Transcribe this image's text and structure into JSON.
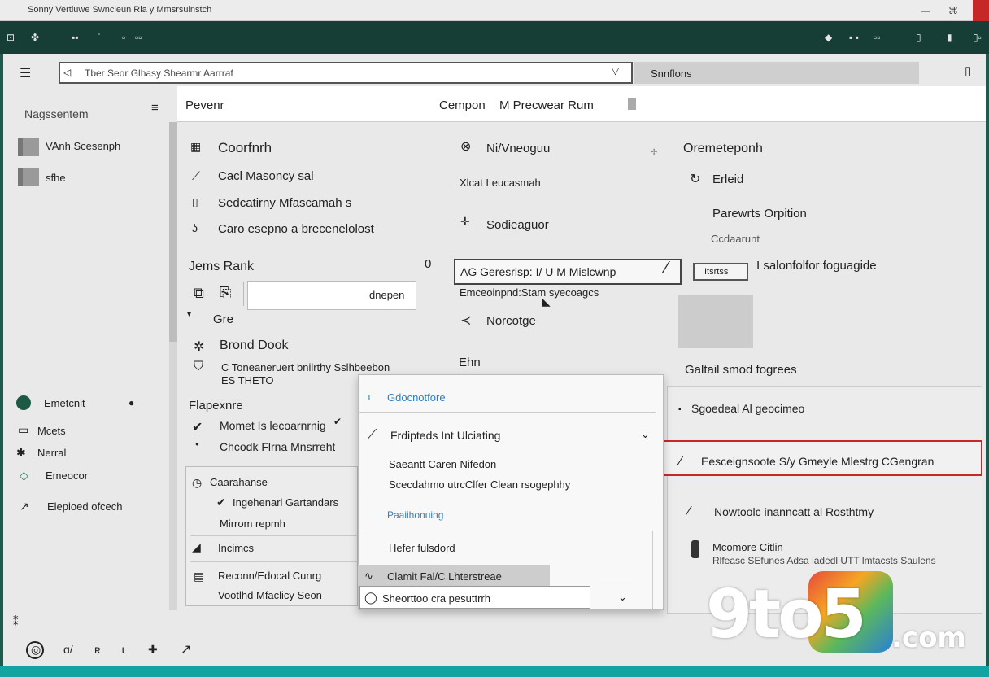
{
  "window": {
    "title": "Sonny Vertiuwe Swncleun Ria y Mmsrsulnstch"
  },
  "topbar": {
    "left_icons": [
      "⊡",
      "✤",
      "▪▪",
      "ˈ",
      "▫",
      "▫▫"
    ],
    "right_icons": [
      "◆",
      "▪ ▪",
      "▫▫",
      "▯",
      "▮",
      "▯▫"
    ]
  },
  "header": {
    "address_text": "Tber Seor Glhasy Shearmr Aarrraf",
    "search_label": "Snnflons"
  },
  "sidebar": {
    "title": "Nagssentem",
    "items": [
      {
        "label": "VAnh Scesenph"
      },
      {
        "label": "sfhe"
      }
    ],
    "lower_items": [
      {
        "icon": "●",
        "label": "Emetcnit"
      },
      {
        "icon": "▭",
        "label": "Mcets"
      },
      {
        "icon": "✱",
        "label": "Nerral"
      },
      {
        "icon": "◇",
        "label": "Emeocor"
      },
      {
        "icon": "↗",
        "label": "Elepioed ofcech"
      }
    ]
  },
  "tabbar": {
    "left_label": "Pevenr",
    "center_label": "Cempon",
    "center_label2": "M Precwear Rum"
  },
  "main": {
    "col1": {
      "heading": "Coorfnrh",
      "items": [
        "Cacl Masoncy sal",
        "Sedcatirny Mfascamah s",
        "Caro esepno a brecenelolost"
      ],
      "section": "Jems Rank",
      "input_value": "dnepen",
      "zero": "0",
      "sub": "Gre",
      "brand_heading": "Brond Dook",
      "brand_line1": "C Toneaneruert bnilrthy Sslhbeebon",
      "brand_line2": "ES THETO",
      "group_heading": "Flapexnre",
      "group_items": [
        "Momet Is lecoarnrnig",
        "Chcodk Flrna Mnsrreht"
      ],
      "list_heading": "Caarahanse",
      "list_items": [
        "Ingehenarl Gartandars",
        "Mirrom repmh",
        "Incimcs",
        "Reconn/Edocal Cunrg",
        "Vootlhd Mfaclicy Seon"
      ]
    },
    "col2": {
      "rows": [
        "Ni/Vneoguu",
        "Xlcat Leucasmah",
        "Sodieaguor"
      ],
      "combo_value": "AG Geresrisp: I/ U M Mislcwnp",
      "combo_sub": "Emceoinpnd:Stam syecoagcs",
      "row_after": "Norcotge",
      "label_eh": "Ehn"
    },
    "col3": {
      "heading": "Oremeteponh",
      "bullet": "Erleid",
      "sub_heading": "Parewrts Orpition",
      "caption": "Ccdaarunt",
      "mini_btn": "Itsrtss",
      "right_text": "I salonfolfor foguagide",
      "section": "Galtail smod fogrees"
    }
  },
  "dropdown": {
    "header": "Gdocnotfore",
    "item1": "Frdipteds Int Ulciating",
    "item2": "Saeantt Caren Nifedon",
    "item3": "Scecdahmo utrcClfer Clean rsogephhy",
    "section": "Paaiihonuing",
    "item4": "Hefer fulsdord",
    "item5": "Clamit Fal/C Lhterstreae",
    "input_text": "Sheorttoo cra pesuttrrh"
  },
  "right_panel": {
    "row1": "Sgoedeal Al geocimeo",
    "selected": "Eesceignsoote S/y Gmeyle Mlestrg CGengran",
    "row3": "Nowtoolc inanncatt al Rosthtmy",
    "row4_title": "Mcomore Citlin",
    "row4_sub": "Rlfeasc SEfunes Adsa ladedl UTT lmtacsts Saulens"
  },
  "logo": {
    "part1": "9to5",
    "part2": ".com"
  },
  "statusbar": {
    "icons": [
      "◎",
      "ɑ/",
      "ʀ",
      "ɩ",
      "✚",
      "↗"
    ]
  }
}
